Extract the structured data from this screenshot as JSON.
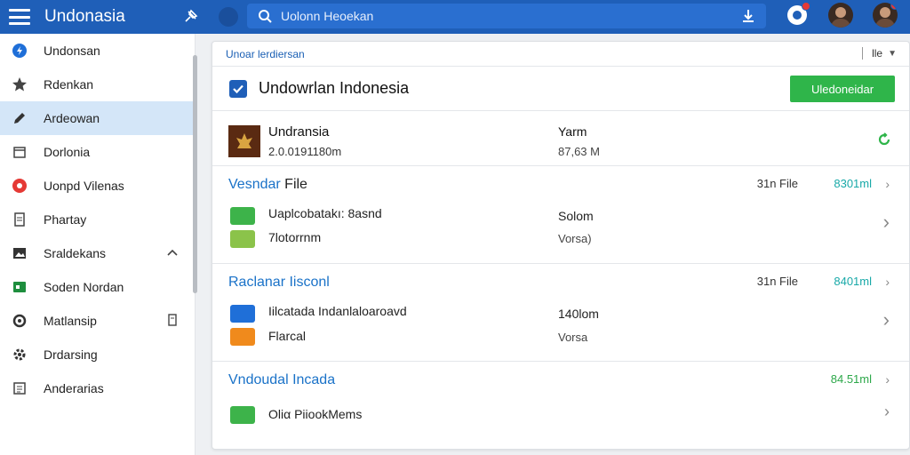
{
  "topbar": {
    "title": "Undonasia",
    "search_text": "Uolonn Heoekan"
  },
  "sidebar": {
    "items": [
      {
        "label": "Undonsan"
      },
      {
        "label": "Rdenkan"
      },
      {
        "label": "Ardeowan"
      },
      {
        "label": "Dorlonia"
      },
      {
        "label": "Uonpd Vilenas"
      },
      {
        "label": "Phartay"
      },
      {
        "label": "Sraldekans"
      },
      {
        "label": "Soden Nordan"
      },
      {
        "label": "Matlansip"
      },
      {
        "label": "Drdarsing"
      },
      {
        "label": "Anderarias"
      }
    ]
  },
  "panel": {
    "head_label": "Unoar lerdiersan",
    "head_right": "lle",
    "title": "Undowrlan Indonesia",
    "primary_button": "Uledoneidar",
    "summary": {
      "name": "Undransia",
      "size": "2.0.0191180m",
      "h1": "Yarm",
      "h2": "87,63 M"
    },
    "groups": [
      {
        "title": "Vesndar",
        "title_dark": "File",
        "count": "31n File",
        "size": "8301ml",
        "files": [
          {
            "name": "Uaplcobatakı: 8asnd",
            "value": "Solom"
          },
          {
            "name": "7lotorrnm",
            "value": "Vorsa)"
          }
        ]
      },
      {
        "title": "Raclanar Iisconl",
        "title_dark": "",
        "count": "31n File",
        "size": "8401ml",
        "files": [
          {
            "name": "Iilcatada Indanlaloaroavd",
            "value": "140lom"
          },
          {
            "name": "Flarcal",
            "value": "Vorsa"
          }
        ]
      },
      {
        "title": "Vndoudal Incada",
        "title_dark": "",
        "count": "",
        "size": "84.51ml",
        "files": [
          {
            "name": "Oliα PiiookMems",
            "value": ""
          }
        ]
      }
    ]
  },
  "colors": {
    "topbar": "#1f5fb8",
    "accent_green": "#2fb54a",
    "link_blue": "#1a72c8",
    "size_teal": "#19a9a8"
  }
}
